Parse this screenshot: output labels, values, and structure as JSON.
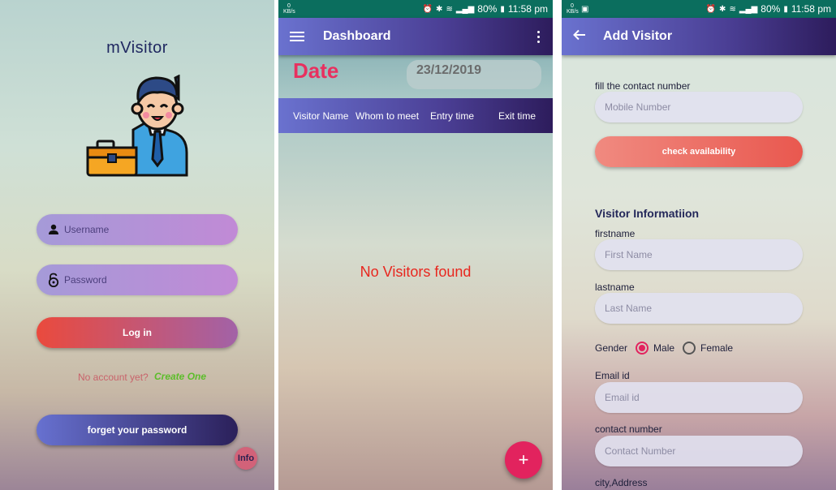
{
  "login": {
    "app_title": "mVisitor",
    "username_placeholder": "Username",
    "password_placeholder": "Password",
    "login_label": "Log in",
    "no_account_text": "No account yet?",
    "create_one_label": "Create One",
    "forget_password_label": "forget your password",
    "info_label": "Info"
  },
  "status": {
    "kb": "0",
    "kb_unit": "KB/s",
    "battery": "80%",
    "time": "11:58 pm"
  },
  "dashboard": {
    "title": "Dashboard",
    "date_label": "Date",
    "date_value": "23/12/2019",
    "columns": [
      "Visitor Name",
      "Whom to meet",
      "Entry time",
      "Exit time"
    ],
    "empty_message": "No Visitors found",
    "fab_label": "+"
  },
  "add_visitor": {
    "title": "Add Visitor",
    "contact_prompt": "fill the contact number",
    "mobile_placeholder": "Mobile Number",
    "check_label": "check availability",
    "section_title": "Visitor Informatiion",
    "firstname_label": "firstname",
    "firstname_placeholder": "First Name",
    "lastname_label": "lastname",
    "lastname_placeholder": "Last Name",
    "gender_label": "Gender",
    "gender_options": [
      "Male",
      "Female"
    ],
    "gender_selected": "Male",
    "email_label": "Email id",
    "email_placeholder": "Email id",
    "contact_label": "contact number",
    "contact_placeholder": "Contact Number",
    "address_label": "city,Address"
  },
  "colors": {
    "appbar_start": "#6a72cf",
    "appbar_end": "#2d1c5c",
    "accent": "#e2235e",
    "statusbar": "#0b6e5e"
  }
}
